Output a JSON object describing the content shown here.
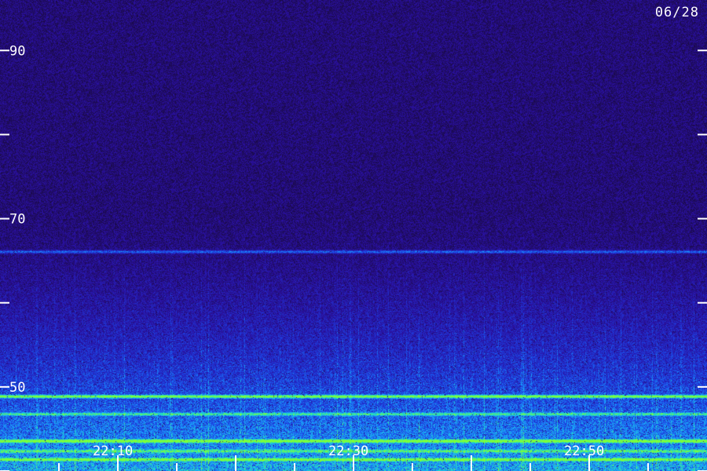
{
  "date_label": "06/28",
  "chart_data": {
    "type": "heatmap",
    "title": "",
    "xlabel": "",
    "ylabel": "",
    "x_tick_labels": [
      "22:10",
      "22:30",
      "22:50"
    ],
    "y_tick_labels": [
      "90",
      "70",
      "50"
    ],
    "y_major_ticks": [
      90,
      80,
      70,
      60,
      50,
      40
    ],
    "ylim": [
      40,
      96
    ],
    "xlim_minutes": [
      22.0,
      23.0
    ],
    "x_major_ticks": [
      "22:10",
      "22:30",
      "22:50"
    ],
    "bands": [
      {
        "y": 48.9,
        "intensity": 0.9
      },
      {
        "y": 46.8,
        "intensity": 0.55
      },
      {
        "y": 43.6,
        "intensity": 0.95
      },
      {
        "y": 42.4,
        "intensity": 0.5
      },
      {
        "y": 41.4,
        "intensity": 0.7
      },
      {
        "y": 66.1,
        "intensity": 0.45
      }
    ],
    "colormap": [
      "#1a0a45",
      "#2a10a0",
      "#1d3fe0",
      "#1aa0ff",
      "#22e0c0",
      "#7dff3a"
    ]
  }
}
